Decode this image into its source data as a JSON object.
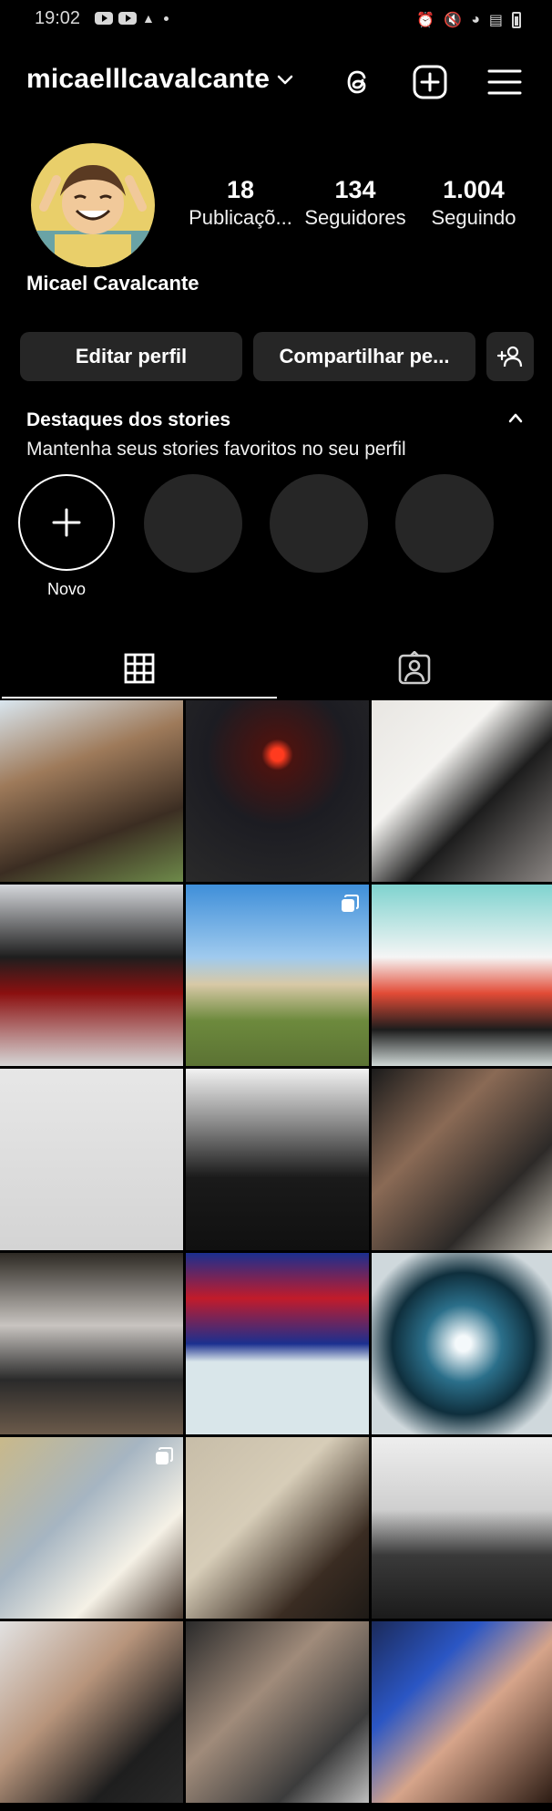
{
  "status_bar": {
    "time": "19:02"
  },
  "header": {
    "username": "micaelllcavalcante"
  },
  "profile": {
    "stats": [
      {
        "value": "18",
        "label": "Publicaçõ..."
      },
      {
        "value": "134",
        "label": "Seguidores"
      },
      {
        "value": "1.004",
        "label": "Seguindo"
      }
    ],
    "full_name": "Micael Cavalcante"
  },
  "actions": {
    "edit_label": "Editar perfil",
    "share_label": "Compartilhar pe..."
  },
  "highlights": {
    "title": "Destaques dos stories",
    "subtitle": "Mantenha seus stories favoritos no seu perfil",
    "new_label": "Novo"
  },
  "tabs": {
    "active": "grid"
  },
  "grid_posts": [
    {
      "bg": "linear-gradient(160deg,#d9e6ef 0%,#9e7a5a 35%,#3b2d22 70%,#6e8a4a 100%)",
      "multi": false
    },
    {
      "bg": "radial-gradient(circle at 50% 30%,#ff3b1f 0 4%,#4a1310 10%,#1c1c22 45%,#2a2a2a 100%)",
      "multi": false
    },
    {
      "bg": "linear-gradient(135deg,#e8e6e2 0%,#f4f3f0 35%,#1d1d1d 60%,#8b8683 100%)",
      "multi": false
    },
    {
      "bg": "linear-gradient(180deg,#d5d7db 0%,#1e1e1e 40%,#8b1010 60%,#d6d6d6 100%)",
      "multi": false
    },
    {
      "bg": "linear-gradient(180deg,#3f8fd9 0%,#9fcaee 40%,#d8c9a6 55%,#6d8a3d 75%,#5b7233 100%)",
      "multi": true
    },
    {
      "bg": "linear-gradient(180deg,#7fd3cf 0%,#f5f5f5 40%,#e24b36 60%,#1d1d1d 80%,#cfd8d6 100%)",
      "multi": false
    },
    {
      "bg": "linear-gradient(180deg,#e7e7e7 0%,#d4d4d4 100%)",
      "multi": false
    },
    {
      "bg": "linear-gradient(180deg,#f2f2f2 0%,#8a8a8a 30%,#1a1a1a 60%,#101010 100%)",
      "multi": false
    },
    {
      "bg": "linear-gradient(135deg,#1b1b1b 0%,#8a6a55 35%,#2d2a28 70%,#c9c4b8 100%)",
      "multi": false
    },
    {
      "bg": "linear-gradient(180deg,#2e2a24 0%,#c8c4c0 40%,#2a2a2a 70%,#6b5a4a 100%)",
      "multi": false
    },
    {
      "bg": "linear-gradient(180deg,#1b2f8f 0%,#c21b2a 25%,#1b2f8f 50%,#d9e6ea 60%,#d9e6ea 100%)",
      "multi": false
    },
    {
      "bg": "radial-gradient(circle at 50% 50%,#f4f9fb 0 6%,#2b6f8a 30%,#0f2f3d 55%,#cfd8dc 80%)",
      "multi": false
    },
    {
      "bg": "linear-gradient(135deg,#c9b98a 0%,#a6b5c2 40%,#f5f1e6 70%,#4b3b30 100%)",
      "multi": true
    },
    {
      "bg": "linear-gradient(135deg,#c7bda8 0%,#d7cdb8 40%,#3a2c22 75%,#1e1a16 100%)",
      "multi": false
    },
    {
      "bg": "linear-gradient(180deg,#eeeeee 0%,#cfcfcf 40%,#3a3a3a 65%,#1b1b1b 100%)",
      "multi": false
    },
    {
      "bg": "linear-gradient(135deg,#e2e2e2 0%,#b8957c 40%,#1e1e1e 75%,#2a2a2a 100%)",
      "multi": false
    },
    {
      "bg": "linear-gradient(135deg,#2a2a2a 0%,#a08b7a 40%,#3c3c3c 75%,#bdbdbd 100%)",
      "multi": false
    },
    {
      "bg": "linear-gradient(135deg,#1b2a5a 0%,#2b56c4 30%,#d6a48a 55%,#2a1a12 100%)",
      "multi": false
    }
  ]
}
